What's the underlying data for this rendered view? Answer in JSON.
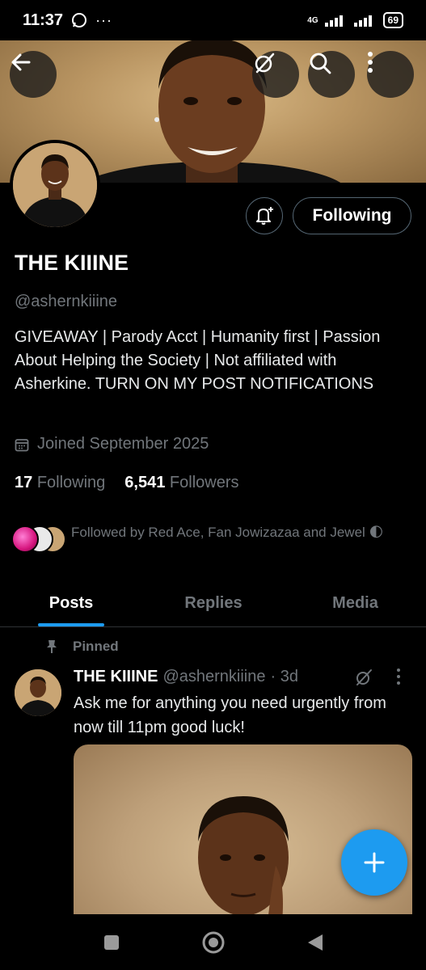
{
  "status_bar": {
    "time": "11:37",
    "battery": "69",
    "network": "4G"
  },
  "profile": {
    "name": "THE KIIINE",
    "handle": "@ashernkiiine",
    "bio": "GIVEAWAY | Parody Acct | Humanity first | Passion About Helping the Society | Not affiliated with Asherkine. TURN ON MY POST NOTIFICATIONS",
    "joined": "Joined September 2025",
    "following_count": "17",
    "following_label": "Following",
    "followers_count": "6,541",
    "followers_label": "Followers",
    "followed_by": "Followed by Red Ace, Fan Jowizazaa and Jewel 🌓",
    "follow_button": "Following"
  },
  "tabs": [
    "Posts",
    "Replies",
    "Media"
  ],
  "post": {
    "pinned_label": "Pinned",
    "author_name": "THE KIIINE",
    "author_handle": "@ashernkiiine",
    "time": "· 3d",
    "text": "Ask me for anything you need urgently from now till 11pm good luck!"
  },
  "colors": {
    "accent": "#1d9bf0",
    "muted": "#71767b",
    "background": "#000000",
    "divider": "#2f3336"
  },
  "icons": [
    "back-arrow-icon",
    "grok-icon",
    "search-icon",
    "more-vertical-icon",
    "bell-plus-icon",
    "calendar-icon",
    "pin-icon",
    "plus-icon",
    "nav-square-icon",
    "nav-circle-icon",
    "nav-back-triangle-icon",
    "whatsapp-icon"
  ]
}
